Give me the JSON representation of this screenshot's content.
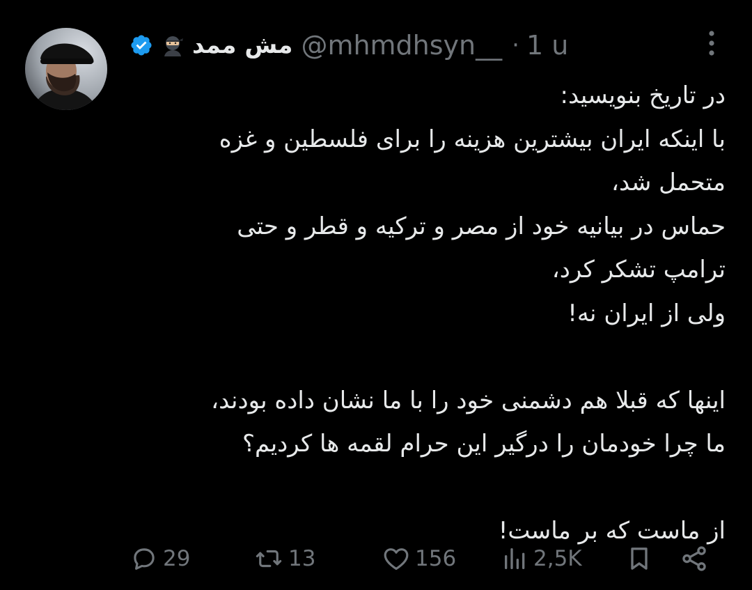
{
  "tweet": {
    "author": {
      "display_name": "مش ممد",
      "emoji": "ninja-emoji",
      "verified_icon": "verified-badge-icon",
      "handle": "@mhmdhsyn__",
      "separator": "·",
      "time": "1 u"
    },
    "body_lines": [
      "در تاریخ بنویسید:",
      "با اینکه ایران بیشترین هزینه را برای فلسطین و غزه",
      "متحمل شد،",
      "حماس در بیانیه خود از مصر و ترکیه و قطر و حتی",
      "ترامپ تشکر کرد،",
      "ولی از ایران نه!",
      "",
      "اینها که قبلا هم دشمنی خود را با ما نشان داده بودند،",
      "ما چرا خودمان را درگیر این حرام لقمه ها کردیم؟",
      "",
      "از ماست که بر ماست!"
    ],
    "actions": {
      "replies": "29",
      "reposts": "13",
      "likes": "156",
      "views": "2,5K"
    },
    "icons": {
      "reply": "comment-icon",
      "repost": "repost-icon",
      "like": "heart-icon",
      "views": "views-chart-icon",
      "bookmark": "bookmark-icon",
      "share": "share-icon",
      "more": "more-vertical-icon"
    },
    "colors": {
      "background": "#000000",
      "text": "#e7e9ea",
      "muted": "#71767b",
      "verified": "#1d9bf0"
    }
  }
}
